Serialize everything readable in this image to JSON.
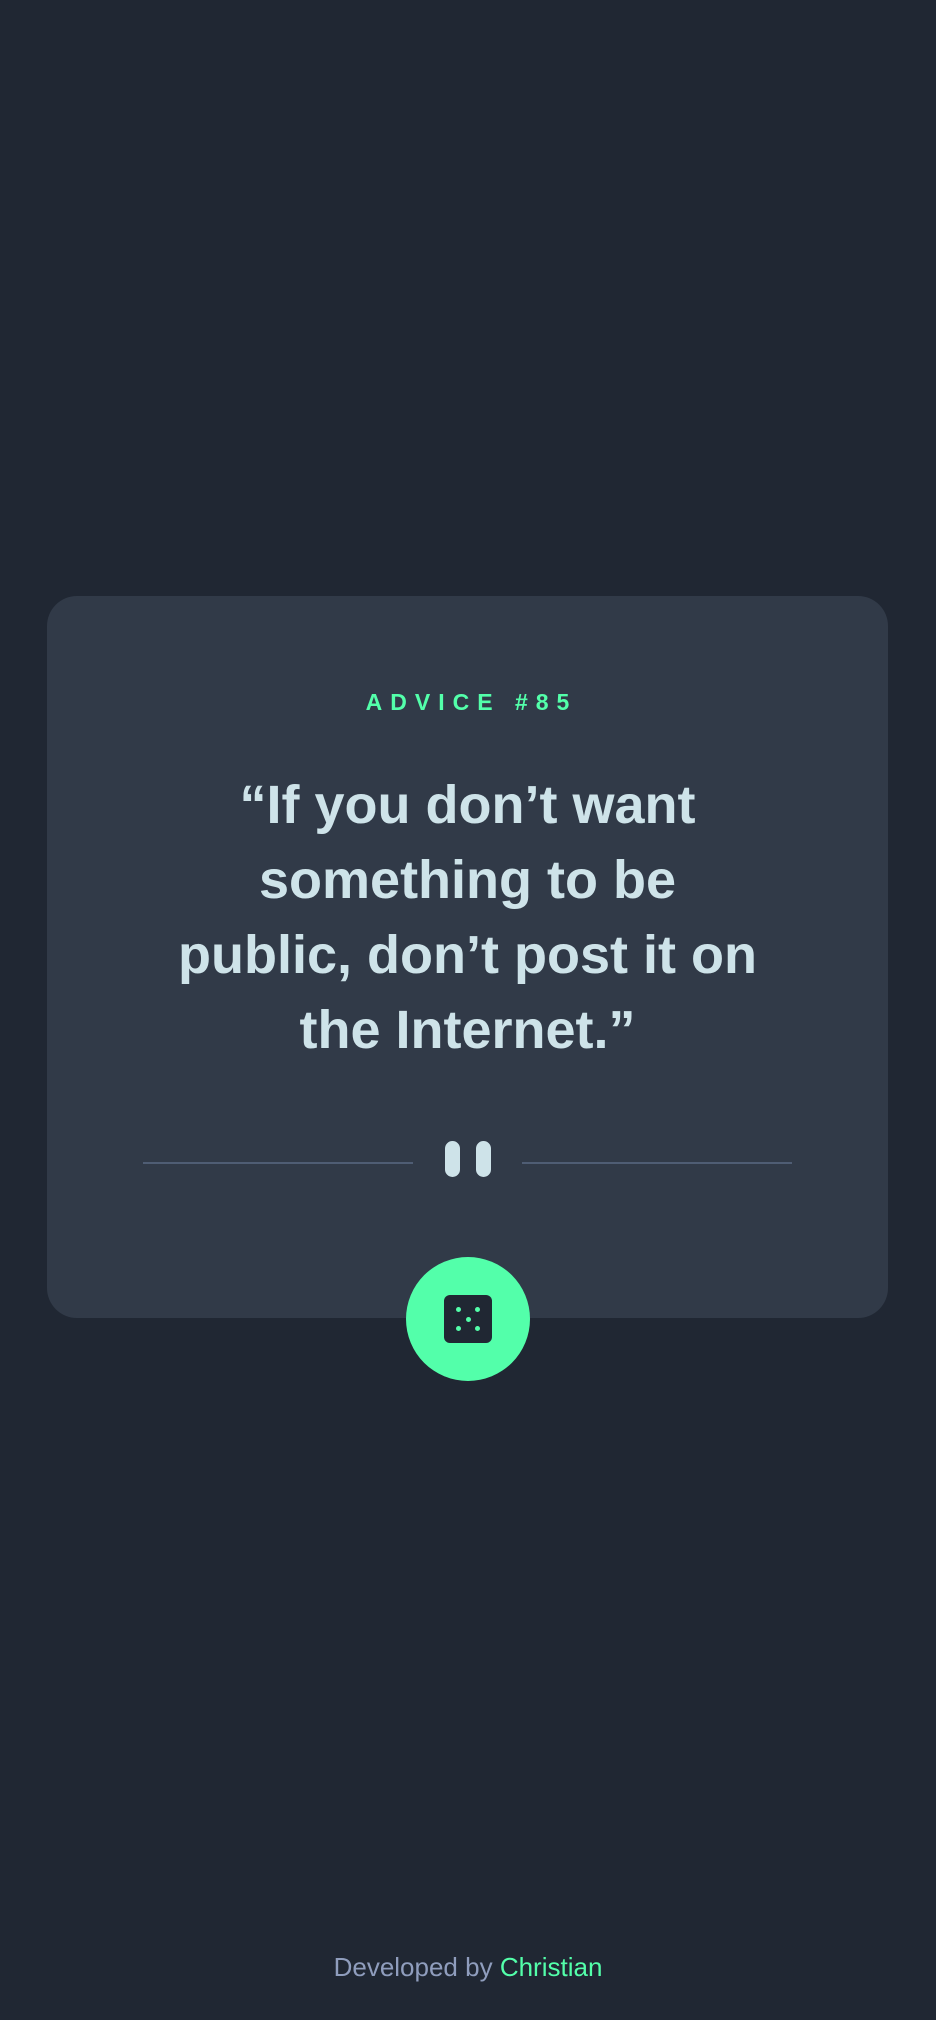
{
  "card": {
    "advice_label": "ADVICE #85",
    "quote": "“If you don’t want something to be public, don’t post it on the Internet.”"
  },
  "icons": {
    "divider": "pause-icon",
    "button": "dice-icon"
  },
  "colors": {
    "background": "#202733",
    "card": "#313a48",
    "accent": "#53ffaa",
    "text": "#cee3e9",
    "divider": "#4f5d74",
    "footer_text": "#8f9dbd"
  },
  "footer": {
    "prefix": "Developed by",
    "author": "Christian"
  }
}
